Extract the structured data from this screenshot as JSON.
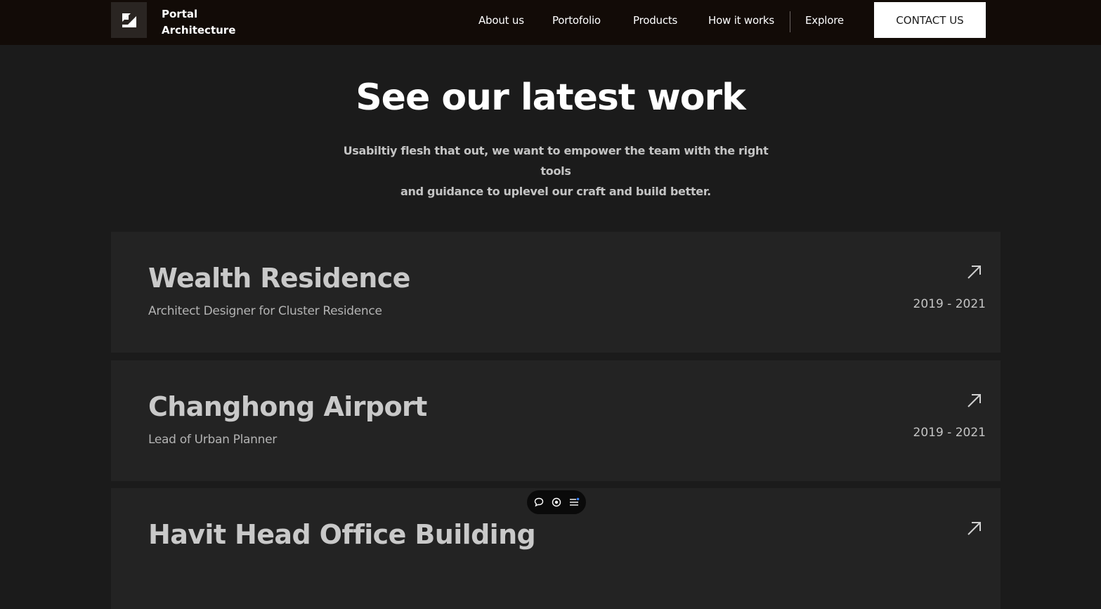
{
  "brand": {
    "line1": "Portal",
    "line2": "Architecture",
    "logo_icon": "portal-logo-icon"
  },
  "nav": {
    "links": [
      "About us",
      "Portofolio",
      "Products",
      "How it works",
      "Explore"
    ],
    "contact_label": "CONTACT US"
  },
  "hero": {
    "title": "See our latest work",
    "subtitle_line1": "Usabiltiy flesh that out, we want to empower the team with the right tools",
    "subtitle_line2": "and guidance to uplevel our craft and build better."
  },
  "projects": [
    {
      "title": "Wealth Residence",
      "role": "Architect Designer for Cluster Residence",
      "years": "2019 - 2021",
      "icon": "arrow-up-right-icon"
    },
    {
      "title": "Changhong Airport",
      "role": "Lead of Urban Planner",
      "years": "2019 - 2021",
      "icon": "arrow-up-right-icon"
    },
    {
      "title": "Havit Head Office Building",
      "role": "",
      "years": "",
      "icon": "arrow-up-right-icon"
    }
  ],
  "toolbar": {
    "icons": [
      "comment-icon",
      "eye-icon",
      "list-icon"
    ]
  },
  "colors": {
    "nav_bg": "#120b07",
    "page_bg": "#1b1b1b",
    "card_bg": "#232323",
    "contact_bg": "#ffffff"
  }
}
